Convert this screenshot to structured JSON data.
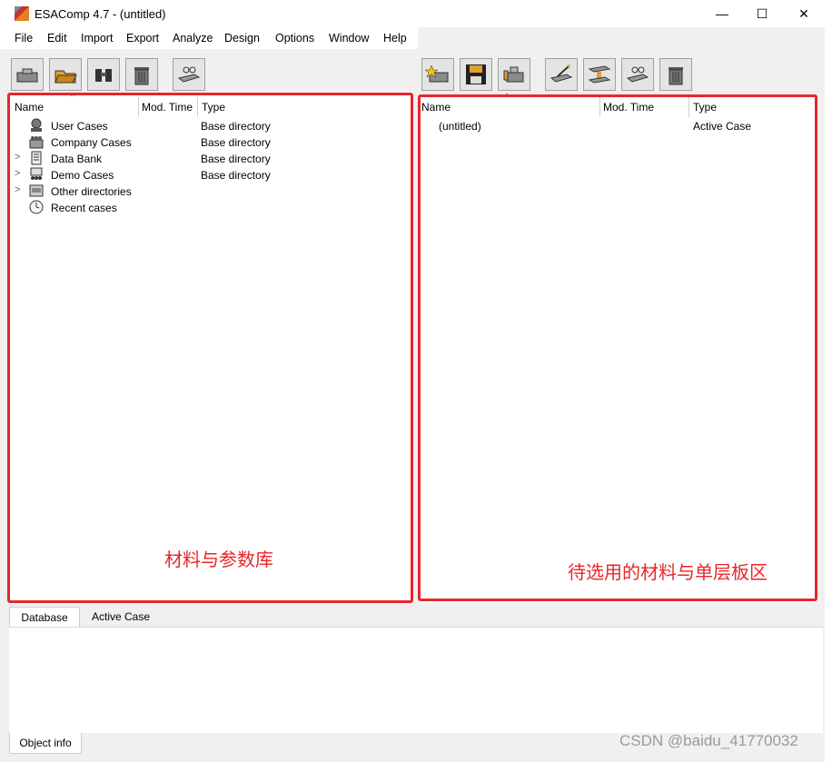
{
  "window": {
    "title": "ESAComp 4.7 - (untitled)",
    "minimize_glyph": "—",
    "maximize_glyph": "☐",
    "close_glyph": "✕"
  },
  "menu": [
    "File",
    "Edit",
    "Import",
    "Export",
    "Analyze",
    "Design",
    "Options",
    "Window",
    "Help"
  ],
  "toolbar_left_icons": [
    "open-case-icon",
    "open-folder-icon",
    "binoculars-icon",
    "trash-icon",
    "view-glasses-icon"
  ],
  "toolbar_right_icons": [
    "new-object-icon",
    "save-disk-icon",
    "edit-object-icon",
    "laminate-edit-icon",
    "ply-stack-icon",
    "view-glasses-icon",
    "trash-icon"
  ],
  "database": {
    "columns": {
      "name": "Name",
      "mod_time": "Mod. Time",
      "type": "Type"
    },
    "rows": [
      {
        "name": "User Cases",
        "type": "Base directory",
        "icon": "user-icon",
        "expandable": false
      },
      {
        "name": "Company Cases",
        "type": "Base directory",
        "icon": "company-icon",
        "expandable": false
      },
      {
        "name": "Data Bank",
        "type": "Base directory",
        "icon": "data-bank-icon",
        "expandable": true
      },
      {
        "name": "Demo Cases",
        "type": "Base directory",
        "icon": "demo-icon",
        "expandable": true
      },
      {
        "name": "Other directories",
        "type": "",
        "icon": "folder-icon",
        "expandable": true
      },
      {
        "name": "Recent cases",
        "type": "",
        "icon": "clock-icon",
        "expandable": false
      }
    ]
  },
  "active_case": {
    "columns": {
      "name": "Name",
      "mod_time": "Mod. Time",
      "type": "Type"
    },
    "rows": [
      {
        "name": "(untitled)",
        "type": "Active Case"
      }
    ]
  },
  "annotations": {
    "left": "材料与参数库",
    "right": "待选用的材料与单层板区",
    "color": "#e8262a"
  },
  "tabs": [
    "Database",
    "Active Case"
  ],
  "info_tab": "Object info",
  "watermark": "CSDN @baidu_41770032"
}
